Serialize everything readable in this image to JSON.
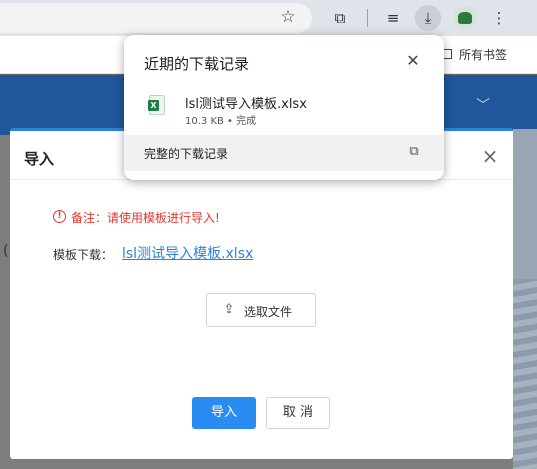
{
  "browser": {
    "bookmarks_bar": {
      "all_bookmarks_label": "所有书签"
    },
    "icons": [
      "star-icon",
      "extension-icon",
      "media-queue-icon",
      "download-icon",
      "profile-avatar",
      "more-menu-icon"
    ]
  },
  "downloads_bubble": {
    "title": "近期的下载记录",
    "items": [
      {
        "file_name": "lsl测试导入模板.xlsx",
        "meta": "10.3 KB • 完成",
        "icon": "excel-file-icon"
      }
    ],
    "full_history_label": "完整的下载记录"
  },
  "dialog": {
    "title": "导入",
    "warning": "备注：请使用模板进行导入!",
    "template_label": "模板下载：",
    "template_link": "lsl测试导入模板.xlsx",
    "pick_file_label": "选取文件",
    "import_button": "导入",
    "cancel_button": "取 消"
  },
  "colors": {
    "primary": "#2a8cf0",
    "warning": "#e2372e",
    "page_header": "#20579b"
  }
}
